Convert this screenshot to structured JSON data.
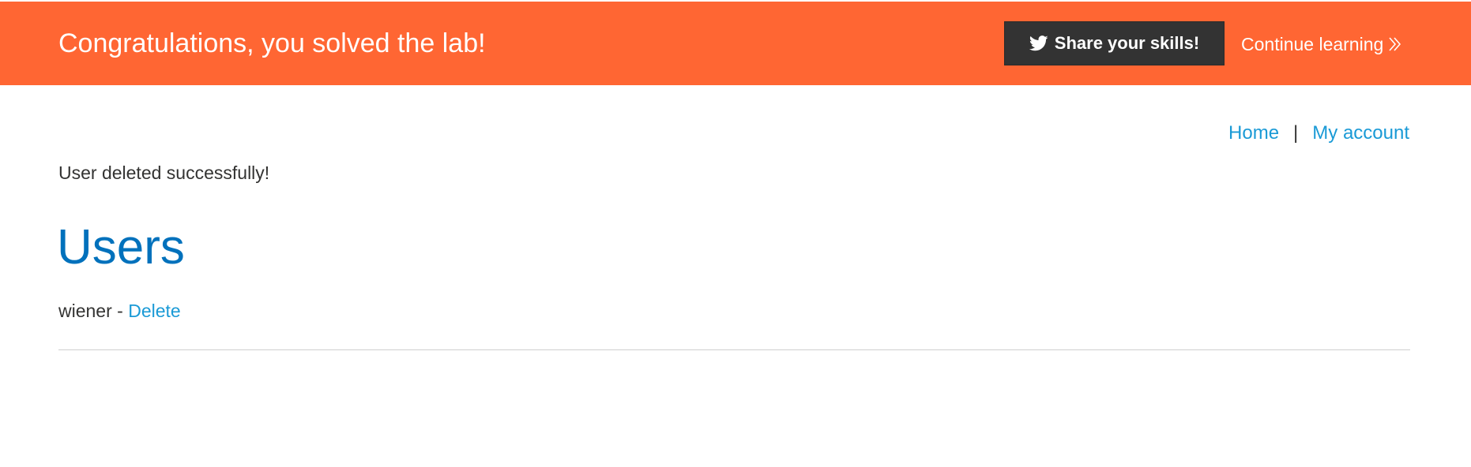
{
  "banner": {
    "title": "Congratulations, you solved the lab!",
    "share_label": "Share your skills!",
    "share_icon": "twitter-icon",
    "continue_label": "Continue learning",
    "continue_icon": "double-chevron-right-icon",
    "background_color": "#ff6633"
  },
  "nav": {
    "home_label": "Home",
    "separator": "|",
    "account_label": "My account",
    "link_color": "#1a9ad6"
  },
  "main": {
    "message": "User deleted successfully!",
    "title": "Users",
    "title_color": "#0071bc",
    "users": [
      {
        "name": "wiener",
        "separator": " - ",
        "action_label": "Delete"
      }
    ]
  }
}
